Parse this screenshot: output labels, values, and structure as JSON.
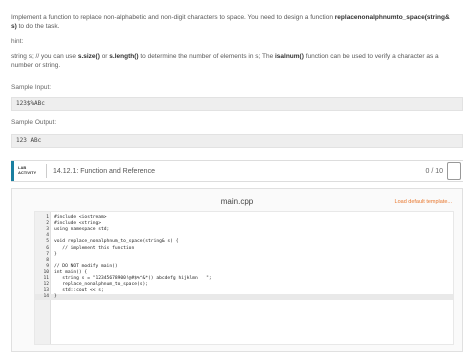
{
  "prompt": {
    "line1": "Implement a function to replace non-alphabetic and non-digit characters to space. You need to design a function",
    "function_name": "replacenonalphnumto_space(string& s)",
    "line1_end": " to do the task.",
    "hint_label": "hint:",
    "hint_a": "string s; // you can use ",
    "hint_size": "s.size()",
    "hint_or": " or ",
    "hint_length": "s.length()",
    "hint_b": " to determine the number of elements in s; The ",
    "hint_isalnum": "isalnum()",
    "hint_c": " function can be used to verify a character as a number or string."
  },
  "sample_input": {
    "label": "Sample Input:",
    "value": "123$%ABc"
  },
  "sample_output": {
    "label": "Sample Output:",
    "value": "123  ABc"
  },
  "lab": {
    "badge_line1": "LAB",
    "badge_line2": "ACTIVITY",
    "title": "14.12.1: Function and Reference",
    "score": "0 / 10"
  },
  "editor": {
    "filename": "main.cpp",
    "load_template": "Load default template..."
  },
  "code_lines": [
    {
      "n": "1",
      "t": "#include <iostream>"
    },
    {
      "n": "2",
      "t": "#include <string>"
    },
    {
      "n": "3",
      "t": "using namespace std;"
    },
    {
      "n": "4",
      "t": ""
    },
    {
      "n": "5",
      "t": "void replace_nonalphnum_to_space(string& s) {"
    },
    {
      "n": "6",
      "t": "   // implement this function"
    },
    {
      "n": "7",
      "t": "}"
    },
    {
      "n": "8",
      "t": ""
    },
    {
      "n": "9",
      "t": "// DO NOT modify main()"
    },
    {
      "n": "10",
      "t": "int main() {"
    },
    {
      "n": "11",
      "t": "   string s = \"12345678900!@#$%^&*() abcdefg hijklmn   \";"
    },
    {
      "n": "12",
      "t": "   replace_nonalphnum_to_space(s);"
    },
    {
      "n": "13",
      "t": "   std::cout << s;"
    },
    {
      "n": "14",
      "t": "}"
    }
  ],
  "active_line": "14"
}
